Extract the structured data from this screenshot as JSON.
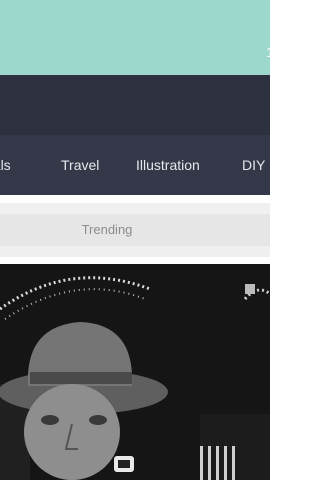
{
  "status_bar": {
    "time_partial": "1"
  },
  "category_tabs": [
    "nals",
    "Travel",
    "Illustration",
    "DIY"
  ],
  "section": {
    "label": "Trending"
  },
  "feed": {
    "photo_alt": "Black-and-white photo of a person wearing a hat"
  },
  "colors": {
    "status_bar_bg": "#9dd8cd",
    "header_bg": "#2d303f",
    "tabs_bg": "#343848",
    "section_bg": "#e6e6e6",
    "section_text": "#8d8d8d"
  }
}
